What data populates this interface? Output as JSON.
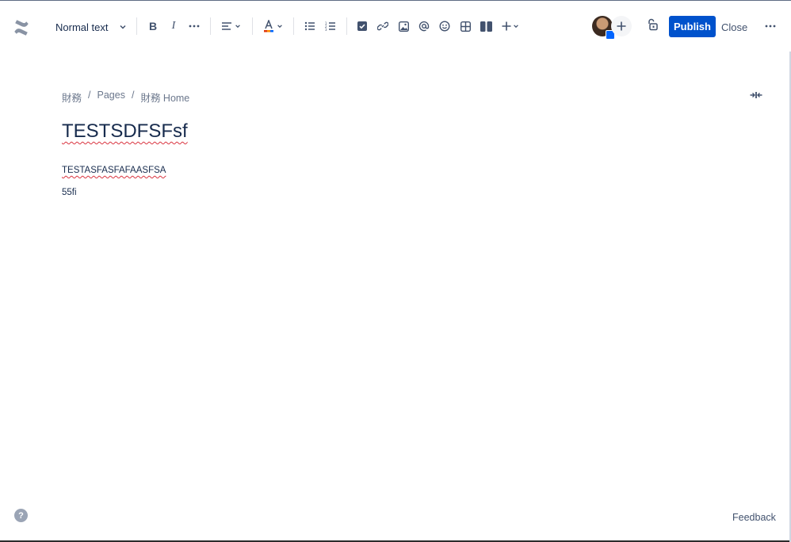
{
  "toolbar": {
    "text_style": "Normal text",
    "bold": "B",
    "italic": "I",
    "publish_label": "Publish",
    "close_label": "Close"
  },
  "breadcrumb": {
    "items": [
      "財務",
      "Pages",
      "財務 Home"
    ],
    "separator": "/"
  },
  "page": {
    "title": "TESTSDFSFsf",
    "paragraphs": [
      "TESTASFASFAFAASFSA",
      "55fi"
    ]
  },
  "footer": {
    "help_icon": "?",
    "feedback_label": "Feedback"
  },
  "colors": {
    "primary": "#0052CC",
    "text": "#172B4D",
    "subtle": "#6B778C"
  }
}
